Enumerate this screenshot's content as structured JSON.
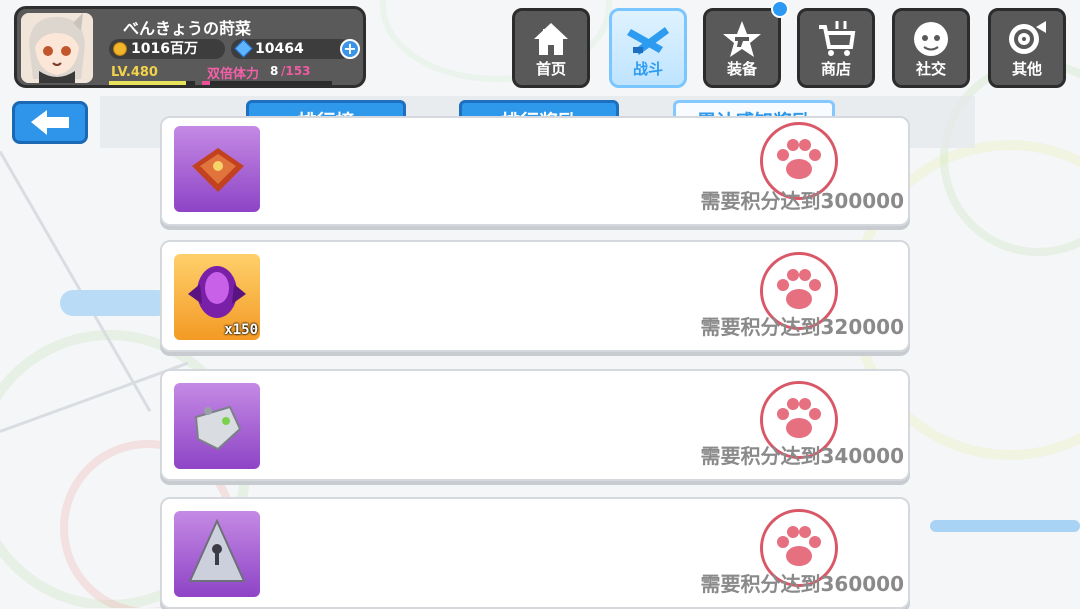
{
  "player": {
    "name": "べんきょうの莳菜",
    "gold": "1016百万",
    "gems": "10464",
    "level": "LV.480",
    "stamina_label": "双倍体力",
    "stamina_value": "8",
    "stamina_max": "/153"
  },
  "nav": [
    {
      "label": "首页",
      "icon": "house-icon"
    },
    {
      "label": "战斗",
      "icon": "swords-icon",
      "active": true
    },
    {
      "label": "装备",
      "icon": "star-gun-icon",
      "notification": true
    },
    {
      "label": "商店",
      "icon": "cart-icon"
    },
    {
      "label": "社交",
      "icon": "face-icon"
    },
    {
      "label": "其他",
      "icon": "target-icon"
    }
  ],
  "tabs": [
    {
      "label": "排行榜"
    },
    {
      "label": "排行奖励"
    },
    {
      "label": "累计感知奖励",
      "selected": true
    }
  ],
  "rewards": [
    {
      "item": "red-gem-icon",
      "quantity": "",
      "requirement": "需要积分达到300000"
    },
    {
      "item": "purple-crystal-icon",
      "quantity": "x150",
      "requirement": "需要积分达到320000"
    },
    {
      "item": "silver-badge-icon",
      "quantity": "",
      "requirement": "需要积分达到340000"
    },
    {
      "item": "pyramid-key-icon",
      "quantity": "",
      "requirement": "需要积分达到360000"
    }
  ],
  "colors": {
    "accent": "#2e98ea",
    "stamp": "#d33b4e",
    "panel": "#5a5a5a"
  }
}
